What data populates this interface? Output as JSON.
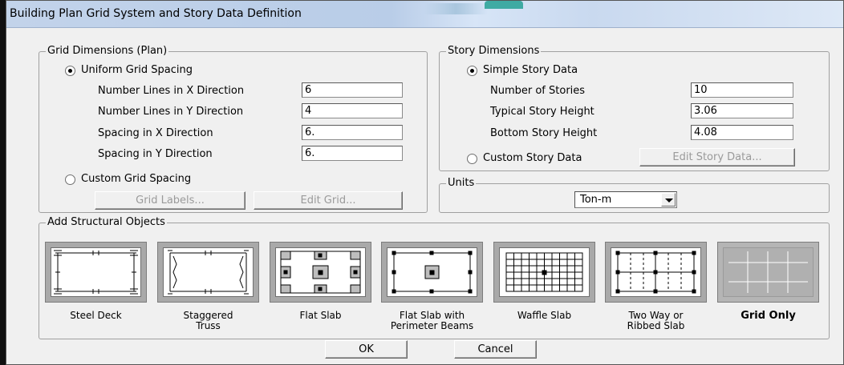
{
  "window": {
    "title": "Building Plan Grid System and Story Data Definition"
  },
  "grid_dimensions": {
    "legend": "Grid Dimensions (Plan)",
    "uniform_option": "Uniform Grid Spacing",
    "fields": [
      {
        "label": "Number Lines in X Direction",
        "value": "6"
      },
      {
        "label": "Number Lines in Y Direction",
        "value": "4"
      },
      {
        "label": "Spacing in X Direction",
        "value": "6."
      },
      {
        "label": "Spacing in Y Direction",
        "value": "6."
      }
    ],
    "custom_option": "Custom Grid Spacing",
    "grid_labels_button": "Grid Labels...",
    "edit_grid_button": "Edit Grid...",
    "selected": "uniform"
  },
  "story_dimensions": {
    "legend": "Story Dimensions",
    "simple_option": "Simple Story Data",
    "fields": [
      {
        "label": "Number of Stories",
        "value": "10"
      },
      {
        "label": "Typical Story Height",
        "value": "3.06"
      },
      {
        "label": "Bottom Story Height",
        "value": "4.08"
      }
    ],
    "custom_option": "Custom Story Data",
    "edit_story_button": "Edit Story Data...",
    "selected": "simple"
  },
  "units": {
    "legend": "Units",
    "selected": "Ton-m"
  },
  "structural_objects": {
    "legend": "Add Structural Objects",
    "items": [
      {
        "label": "Steel Deck",
        "icon": "steel-deck-icon"
      },
      {
        "label": "Staggered\nTruss",
        "icon": "staggered-truss-icon"
      },
      {
        "label": "Flat Slab",
        "icon": "flat-slab-icon"
      },
      {
        "label": "Flat Slab with\nPerimeter Beams",
        "icon": "flat-slab-perimeter-beams-icon"
      },
      {
        "label": "Waffle Slab",
        "icon": "waffle-slab-icon"
      },
      {
        "label": "Two Way or\nRibbed Slab",
        "icon": "ribbed-slab-icon"
      },
      {
        "label": "Grid Only",
        "icon": "grid-only-icon"
      }
    ],
    "selected": "Grid Only"
  },
  "buttons": {
    "ok": "OK",
    "cancel": "Cancel"
  }
}
